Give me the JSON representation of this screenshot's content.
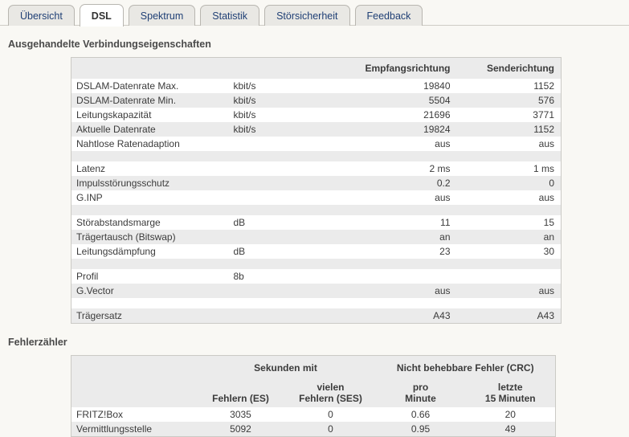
{
  "tabs": [
    {
      "label": "Übersicht",
      "active": false
    },
    {
      "label": "DSL",
      "active": true
    },
    {
      "label": "Spektrum",
      "active": false
    },
    {
      "label": "Statistik",
      "active": false
    },
    {
      "label": "Störsicherheit",
      "active": false
    },
    {
      "label": "Feedback",
      "active": false
    }
  ],
  "sections": {
    "properties": {
      "title": "Ausgehandelte Verbindungseigenschaften",
      "headers": {
        "blank": "",
        "unit": "",
        "downstream": "Empfangsrichtung",
        "upstream": "Senderichtung"
      },
      "rows": [
        {
          "label": "DSLAM-Datenrate Max.",
          "unit": "kbit/s",
          "down": "19840",
          "up": "1152"
        },
        {
          "label": "DSLAM-Datenrate Min.",
          "unit": "kbit/s",
          "down": "5504",
          "up": "576"
        },
        {
          "label": "Leitungskapazität",
          "unit": "kbit/s",
          "down": "21696",
          "up": "3771"
        },
        {
          "label": "Aktuelle Datenrate",
          "unit": "kbit/s",
          "down": "19824",
          "up": "1152"
        },
        {
          "label": "Nahtlose Ratenadaption",
          "unit": "",
          "down": "aus",
          "up": "aus"
        },
        {
          "spacer": true
        },
        {
          "label": "Latenz",
          "unit": "",
          "down": "2 ms",
          "up": "1 ms"
        },
        {
          "label": "Impulsstörungsschutz",
          "unit": "",
          "down": "0.2",
          "up": "0"
        },
        {
          "label": "G.INP",
          "unit": "",
          "down": "aus",
          "up": "aus"
        },
        {
          "spacer": true
        },
        {
          "label": "Störabstandsmarge",
          "unit": "dB",
          "down": "11",
          "up": "15"
        },
        {
          "label": "Trägertausch (Bitswap)",
          "unit": "",
          "down": "an",
          "up": "an"
        },
        {
          "label": "Leitungsdämpfung",
          "unit": "dB",
          "down": "23",
          "up": "30"
        },
        {
          "spacer": true
        },
        {
          "label": "Profil",
          "unit": "8b",
          "down": "",
          "up": ""
        },
        {
          "label": "G.Vector",
          "unit": "",
          "down": "aus",
          "up": "aus"
        },
        {
          "spacer": true
        },
        {
          "label": "Trägersatz",
          "unit": "",
          "down": "A43",
          "up": "A43"
        }
      ]
    },
    "errors": {
      "title": "Fehlerzähler",
      "group_headers": {
        "blank": "",
        "seconds": "Sekunden mit",
        "crc": "Nicht behebbare Fehler (CRC)"
      },
      "sub_headers": {
        "blank": "",
        "es": "Fehlern (ES)",
        "ses": "vielen\nFehlern (SES)",
        "ses_line1": "vielen",
        "ses_line2": "Fehlern (SES)",
        "per_minute_line1": "pro",
        "per_minute_line2": "Minute",
        "last15_line1": "letzte",
        "last15_line2": "15 Minuten"
      },
      "rows": [
        {
          "name": "FRITZ!Box",
          "es": "3035",
          "ses": "0",
          "per_minute": "0.66",
          "last15": "20"
        },
        {
          "name": "Vermittlungsstelle",
          "es": "5092",
          "ses": "0",
          "per_minute": "0.95",
          "last15": "49"
        }
      ]
    }
  },
  "colors": {
    "page_bg": "#f9f8f4",
    "tab_active_bg": "#ffffff",
    "tab_inactive_bg": "#e9e8e4",
    "tab_link": "#1f3f75",
    "row_alt_bg": "#ebebeb",
    "border": "#cbcac5"
  }
}
